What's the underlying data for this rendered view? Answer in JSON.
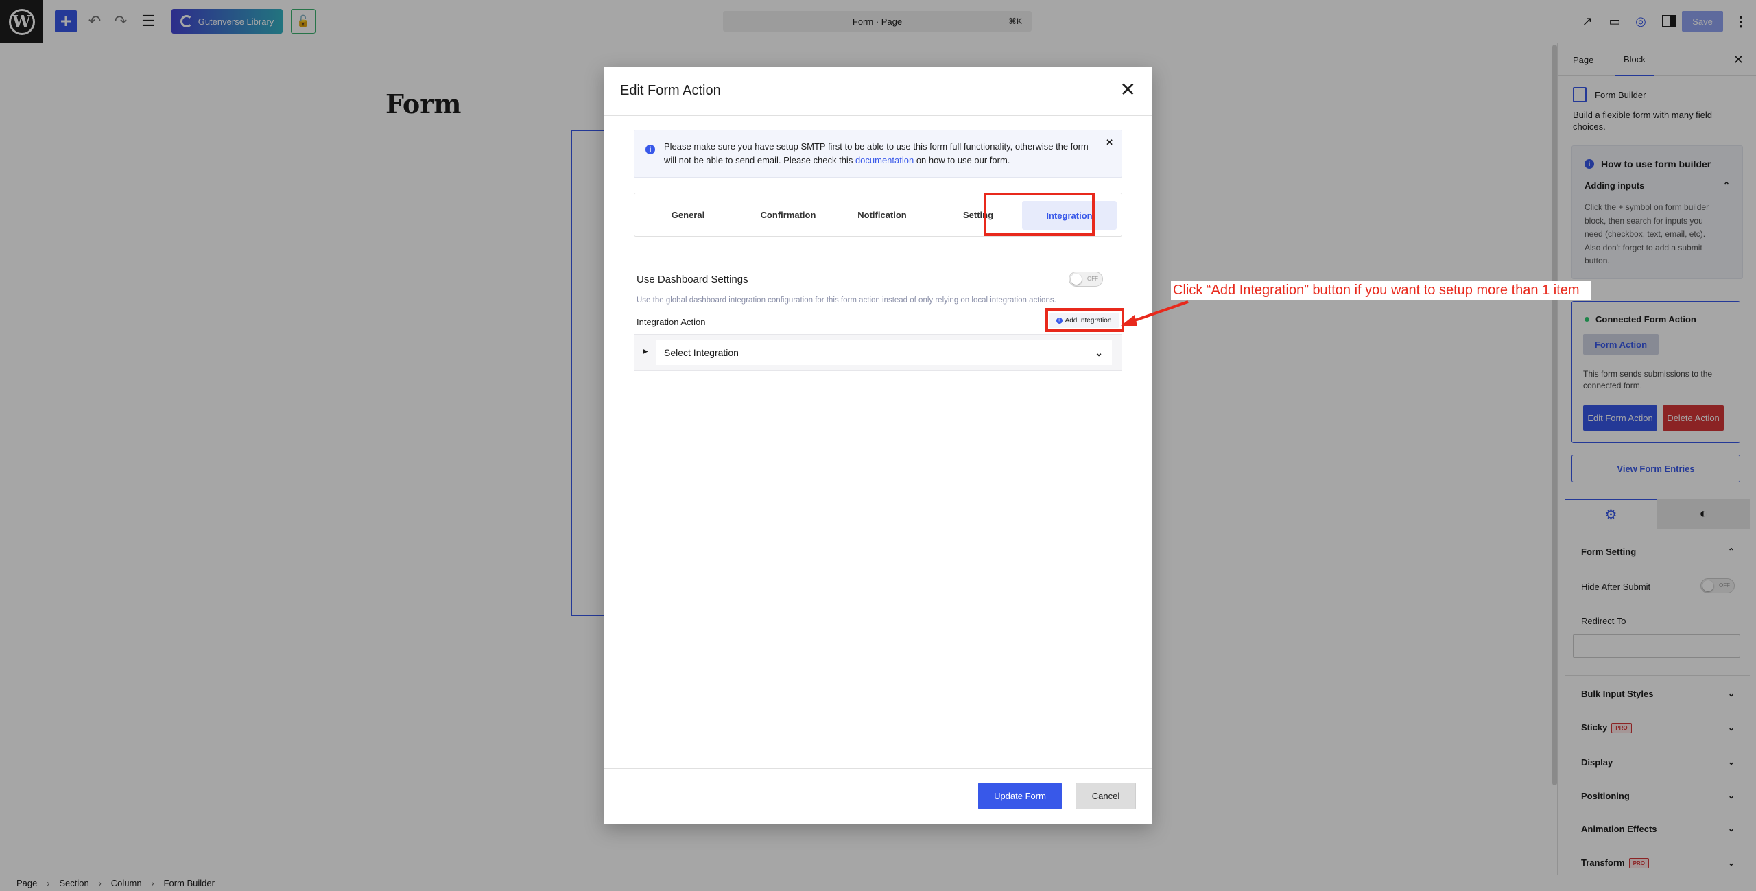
{
  "topbar": {
    "wp_logo": "W",
    "library_label": "Gutenverse Library",
    "doc_title": "Form · Page",
    "shortcut": "⌘K",
    "save_label": "Save"
  },
  "canvas": {
    "page_heading": "Form"
  },
  "sidebar": {
    "tab_page": "Page",
    "tab_block": "Block",
    "block_name": "Form Builder",
    "block_desc": "Build a flexible form with many field choices.",
    "howto_title": "How to use form builder",
    "howto_sub": "Adding inputs",
    "howto_text": "Click the + symbol on form builder block, then search for inputs you need (checkbox, text, email, etc). Also don't forget to add a submit button.",
    "connected_title": "Connected Form Action",
    "connected_chip": "Form Action",
    "connected_desc": "This form sends submissions to the connected form.",
    "edit_action": "Edit Form Action",
    "delete_action": "Delete Action",
    "view_entries": "View Form Entries",
    "form_setting": "Form Setting",
    "hide_after_submit": "Hide After Submit",
    "toggle_off": "OFF",
    "redirect_to": "Redirect To",
    "sections": {
      "bulk": "Bulk Input Styles",
      "sticky": "Sticky",
      "display": "Display",
      "positioning": "Positioning",
      "animation": "Animation Effects",
      "transform": "Transform"
    },
    "pro_badge": "PRO"
  },
  "breadcrumbs": [
    "Page",
    "Section",
    "Column",
    "Form Builder"
  ],
  "modal": {
    "title": "Edit Form Action",
    "notice_before": "Please make sure you have setup SMTP first to be able to use this form full functionality, otherwise the form will not be able to send email. Please check this ",
    "notice_link": "documentation",
    "notice_after": " on how to use our form.",
    "tabs": {
      "general": "General",
      "confirmation": "Confirmation",
      "notification": "Notification",
      "setting": "Setting",
      "integration": "Integration"
    },
    "dash_label": "Use Dashboard Settings",
    "dash_toggle": "OFF",
    "dash_desc": "Use the global dashboard integration configuration for this form action instead of only relying on local integration actions.",
    "integration_action_label": "Integration Action",
    "add_integration": "Add Integration",
    "select_integration": "Select Integration",
    "update_button": "Update Form",
    "cancel_button": "Cancel"
  },
  "annotation": {
    "callout": "Click “Add Integration” button if you want to setup more than 1 item",
    "highlight_color": "#e8291c"
  },
  "colors": {
    "accent": "#3858e9",
    "danger": "#d63638",
    "annotation": "#e8291c"
  }
}
